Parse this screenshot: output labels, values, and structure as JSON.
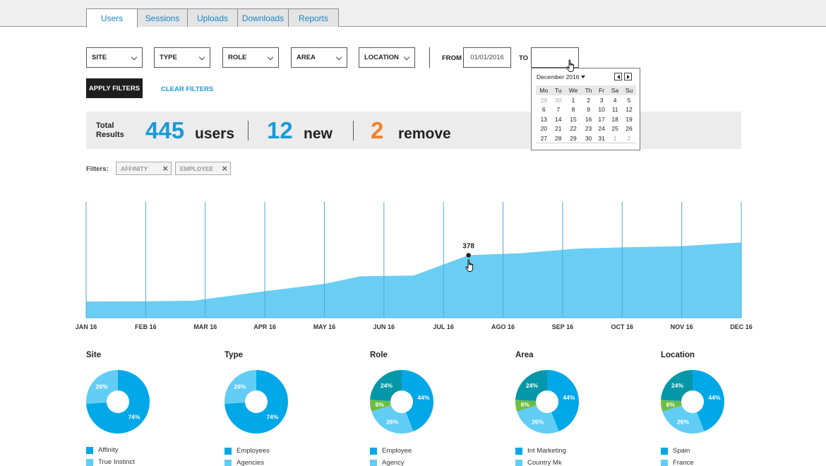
{
  "tabs": [
    "Users",
    "Sessions",
    "Uploads",
    "Downloads",
    "Reports"
  ],
  "active_tab": "Users",
  "filters": {
    "selects": [
      "SITE",
      "TYPE",
      "ROLE",
      "AREA",
      "LOCATION"
    ],
    "from_label": "FROM",
    "from_value": "01/01/2016",
    "to_label": "TO",
    "to_value": "",
    "apply_label": "APPLY FILTERS",
    "clear_label": "CLEAR FILTERS"
  },
  "summary": {
    "total_label_1": "Total",
    "total_label_2": "Results",
    "users_num": "445",
    "users_word": "users",
    "new_num": "12",
    "new_word": "new",
    "remove_num": "2",
    "remove_word": "remove"
  },
  "active_filters": {
    "label": "Filters:",
    "chips": [
      "AFFINITY",
      "EMPLOYEE"
    ]
  },
  "calendar": {
    "month_label": "December 2016",
    "weekdays": [
      "Mo",
      "Tu",
      "We",
      "Th",
      "Fr",
      "Sa",
      "Su"
    ],
    "weeks": [
      [
        "29",
        "30",
        "1",
        "2",
        "3",
        "4",
        "5"
      ],
      [
        "6",
        "7",
        "8",
        "9",
        "10",
        "11",
        "12"
      ],
      [
        "13",
        "14",
        "15",
        "16",
        "17",
        "18",
        "19"
      ],
      [
        "20",
        "21",
        "22",
        "23",
        "24",
        "25",
        "26"
      ],
      [
        "27",
        "28",
        "29",
        "30",
        "31",
        "1",
        "2"
      ]
    ],
    "muted": [
      [
        0,
        0
      ],
      [
        0,
        1
      ],
      [
        4,
        5
      ],
      [
        4,
        6
      ]
    ]
  },
  "chart_data": {
    "type": "area",
    "categories": [
      "JAN 16",
      "FEB 16",
      "MAR 16",
      "APR 16",
      "MAY 16",
      "JUN 16",
      "JUL 16",
      "AGO 16",
      "SEP 16",
      "OCT 16",
      "NOV 16",
      "DEC 16"
    ],
    "x": [
      0,
      0.5,
      1,
      1.5,
      2,
      2.5,
      3,
      3.5,
      4,
      4.5,
      5,
      5.5,
      6,
      6.42,
      6.5,
      7,
      7.3,
      8,
      8.25,
      9,
      10,
      11
    ],
    "y": [
      98,
      99,
      100,
      103,
      110,
      133,
      160,
      183,
      205,
      228,
      250,
      253,
      255,
      308,
      312,
      338,
      345,
      355,
      378,
      390,
      400,
      407,
      418
    ],
    "point_x": [
      0,
      1,
      1.8,
      3,
      4,
      4.6,
      5.5,
      6.42,
      7.3,
      8.25,
      9,
      10,
      11
    ],
    "point_y": [
      98,
      99,
      103,
      160,
      205,
      250,
      255,
      378,
      390,
      418,
      425,
      433,
      455
    ],
    "highlight": {
      "x": 6.42,
      "value": 378,
      "label": "378"
    },
    "ylim": [
      0,
      700
    ],
    "grid": "vertical",
    "color": "#6acef4"
  },
  "donuts": [
    {
      "title": "Site",
      "slices": [
        {
          "label": "Affinity",
          "pct": 74,
          "color": "#00a8e8"
        },
        {
          "label": "True Instinct",
          "pct": 26,
          "color": "#62cdf4"
        }
      ]
    },
    {
      "title": "Type",
      "slices": [
        {
          "label": "Employees",
          "pct": 74,
          "color": "#00a8e8"
        },
        {
          "label": "Agencies",
          "pct": 26,
          "color": "#62cdf4"
        }
      ]
    },
    {
      "title": "Role",
      "slices": [
        {
          "label": "Employee",
          "pct": 44,
          "color": "#00a8e8"
        },
        {
          "label": "Agency",
          "pct": 26,
          "color": "#62cdf4"
        },
        {
          "pct": 6,
          "color": "#6cbd45"
        },
        {
          "pct": 24,
          "color": "#0497a8"
        }
      ]
    },
    {
      "title": "Area",
      "slices": [
        {
          "label": "Int Marketing",
          "pct": 44,
          "color": "#00a8e8"
        },
        {
          "label": "Country Mk",
          "pct": 26,
          "color": "#62cdf4"
        },
        {
          "pct": 6,
          "color": "#6cbd45"
        },
        {
          "pct": 24,
          "color": "#0497a8"
        }
      ]
    },
    {
      "title": "Location",
      "slices": [
        {
          "label": "Spain",
          "pct": 44,
          "color": "#00a8e8"
        },
        {
          "label": "France",
          "pct": 26,
          "color": "#62cdf4"
        },
        {
          "pct": 6,
          "color": "#6cbd45"
        },
        {
          "pct": 24,
          "color": "#0497a8"
        }
      ]
    }
  ],
  "colors": {
    "accent_blue": "#1a9ad8",
    "orange": "#f48024",
    "chart_fill": "#6acef4"
  }
}
